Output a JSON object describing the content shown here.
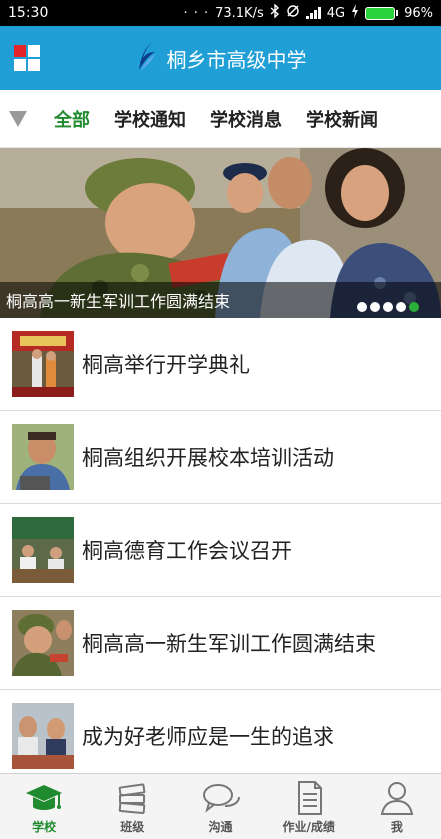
{
  "status_bar": {
    "time": "15:30",
    "indicators": "· · ·",
    "speed": "73.1K/s",
    "network": "4G",
    "battery": "96%"
  },
  "header": {
    "title": "桐乡市高级中学",
    "menu_icon": "grid-menu-icon",
    "logo_icon": "school-logo-icon",
    "colors": {
      "bar": "#1f9fd6",
      "menu_red": "#e2242b",
      "menu_white": "#ffffff"
    }
  },
  "tabs": {
    "items": [
      {
        "label": "全部",
        "active": true
      },
      {
        "label": "学校通知",
        "active": false
      },
      {
        "label": "学校消息",
        "active": false
      },
      {
        "label": "学校新闻",
        "active": false
      }
    ],
    "active_color": "#1f8a2e"
  },
  "banner": {
    "caption": "桐高高一新生军训工作圆满结束",
    "slide_count": 5,
    "active_slide": 5
  },
  "news": [
    {
      "title": "桐高举行开学典礼"
    },
    {
      "title": "桐高组织开展校本培训活动"
    },
    {
      "title": "桐高德育工作会议召开"
    },
    {
      "title": "桐高高一新生军训工作圆满结束"
    },
    {
      "title": "成为好老师应是一生的追求"
    }
  ],
  "bottom_nav": {
    "items": [
      {
        "label": "学校",
        "icon": "graduation-cap-icon",
        "active": true
      },
      {
        "label": "班级",
        "icon": "books-icon",
        "active": false
      },
      {
        "label": "沟通",
        "icon": "chat-bubbles-icon",
        "active": false
      },
      {
        "label": "作业/成绩",
        "icon": "document-icon",
        "active": false
      },
      {
        "label": "我",
        "icon": "user-icon",
        "active": false
      }
    ]
  }
}
